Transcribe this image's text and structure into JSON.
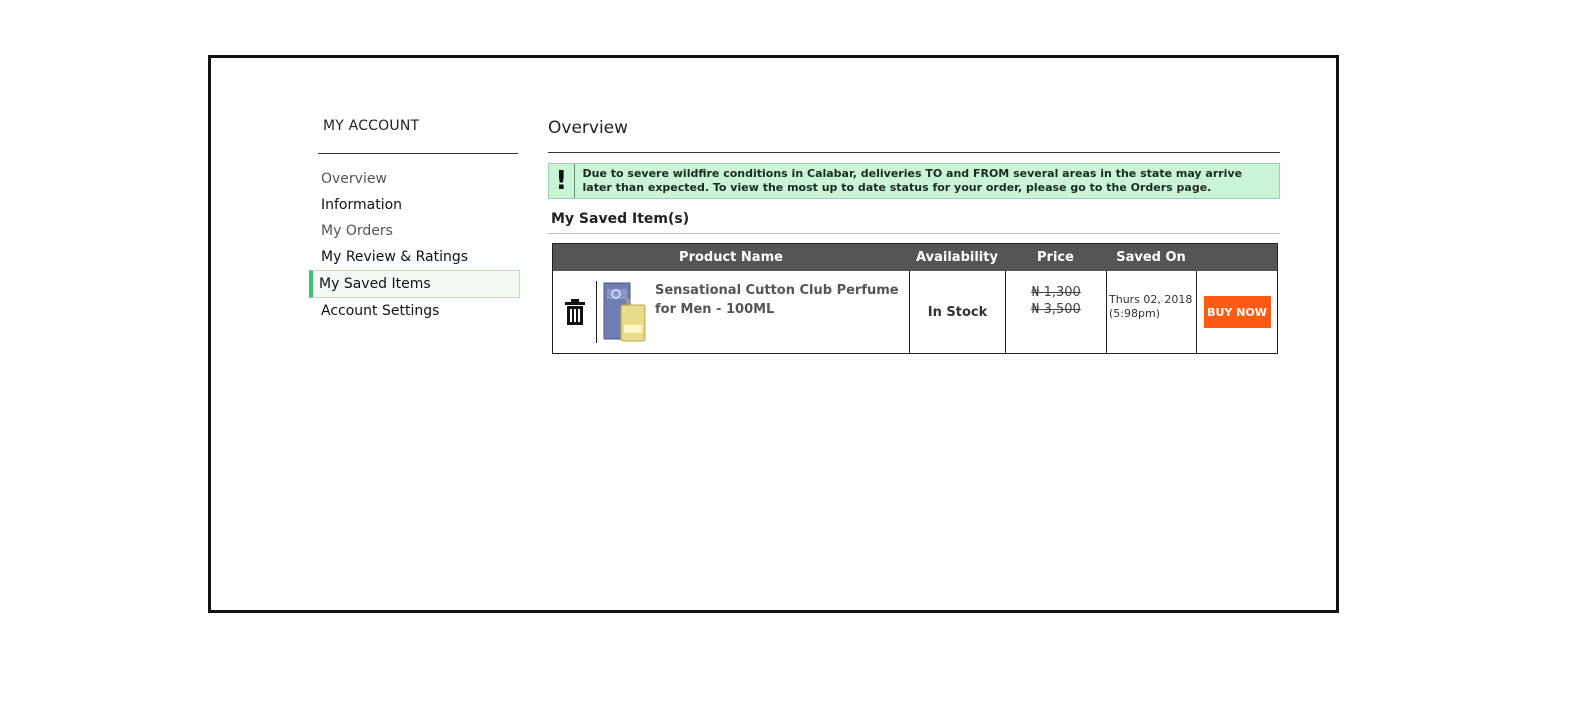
{
  "sidebar": {
    "title": "MY ACCOUNT",
    "items": [
      {
        "label": "Overview"
      },
      {
        "label": "Information"
      },
      {
        "label": "My Orders"
      },
      {
        "label": "My Review & Ratings"
      },
      {
        "label": "My Saved Items"
      },
      {
        "label": "Account Settings"
      }
    ]
  },
  "main": {
    "title": "Overview",
    "notice": {
      "icon": "!",
      "text": "Due to severe wildfire conditions in Calabar, deliveries TO and FROM several areas in the state may arrive later than expected. To view the most up to date status for your order, please go to the Orders page."
    },
    "saved": {
      "title": "My Saved Item(s)",
      "columns": {
        "product": "Product Name",
        "availability": "Availability",
        "price": "Price",
        "saved_on": "Saved On"
      },
      "rows": [
        {
          "product_name": "Sensational Cutton Club Perfume for Men - 100ML",
          "availability": "In Stock",
          "price_now": "₦ 1,300",
          "price_old": "₦ 3,500",
          "saved_on": "Thurs 02, 2018 (5:98pm)",
          "action": "BUY NOW"
        }
      ]
    }
  },
  "colors": {
    "accent_green": "#3ec46d",
    "notice_bg": "#c9f5d6",
    "table_header_bg": "#555555",
    "buy_button": "#ff5a14"
  }
}
